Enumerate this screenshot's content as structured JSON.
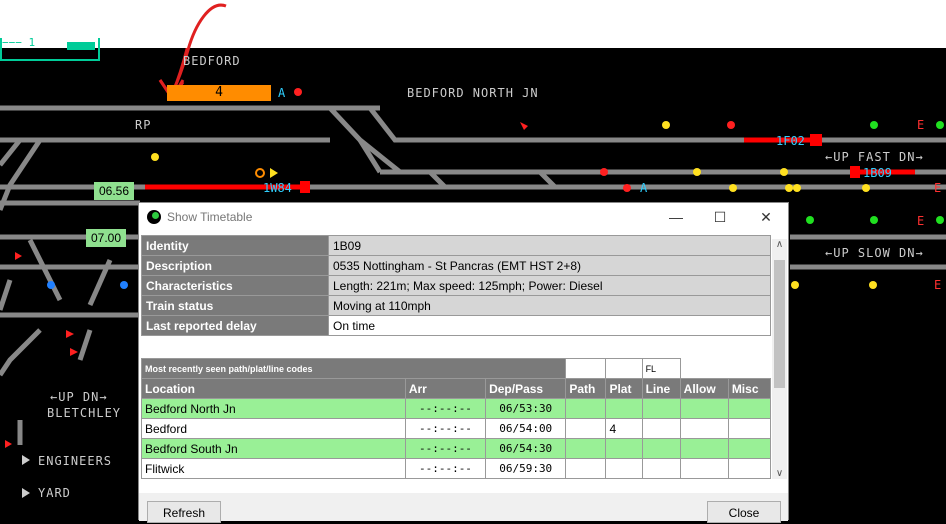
{
  "top_panel_text": "−−− 1",
  "labels": {
    "bedford": "BEDFORD",
    "bedford_north_jn": "BEDFORD NORTH JN",
    "rp": "RP",
    "up_fast_dn": "←UP FAST DN→",
    "up_slow_dn": "←UP SLOW DN→",
    "up_dn": "←UP DN→",
    "bletchley": "BLETCHLEY",
    "engineers": "ENGINEERS",
    "yard": "YARD"
  },
  "berths": {
    "bedford_plat4": "4",
    "train_1f02": "1F02",
    "train_1w84": "1W84",
    "train_1b09": "1B09",
    "sig_a1": "A",
    "sig_a2": "A",
    "sig_e1": "E",
    "sig_e2": "E",
    "sig_e3": "E",
    "sig_e4": "E"
  },
  "times": {
    "t1": "06.56",
    "t2": "07.00"
  },
  "dialog": {
    "title": "Show Timetable",
    "minimize": "—",
    "maximize": "☐",
    "close": "✕",
    "info": [
      {
        "key": "Identity",
        "value": "1B09"
      },
      {
        "key": "Description",
        "value": "0535 Nottingham - St Pancras (EMT HST 2+8)"
      },
      {
        "key": "Characteristics",
        "value": "Length: 221m; Max speed: 125mph; Power: Diesel"
      },
      {
        "key": "Train status",
        "value": "Moving at 110mph"
      },
      {
        "key": "Last reported delay",
        "value": "On time"
      }
    ],
    "codes_header": "Most recently seen path/plat/line codes",
    "codes_values": [
      "",
      "",
      "FL",
      ""
    ],
    "columns": [
      "Location",
      "Arr",
      "Dep/Pass",
      "Path",
      "Plat",
      "Line",
      "Allow",
      "Misc"
    ],
    "rows": [
      {
        "location": "Bedford North Jn",
        "arr": "--:--:--",
        "dep": "06/53:30",
        "path": "",
        "plat": "",
        "line": "",
        "allow": "",
        "misc": ""
      },
      {
        "location": "Bedford",
        "arr": "--:--:--",
        "dep": "06/54:00",
        "path": "",
        "plat": "4",
        "line": "",
        "allow": "",
        "misc": ""
      },
      {
        "location": "Bedford South Jn",
        "arr": "--:--:--",
        "dep": "06/54:30",
        "path": "",
        "plat": "",
        "line": "",
        "allow": "",
        "misc": ""
      },
      {
        "location": "Flitwick",
        "arr": "--:--:--",
        "dep": "06/59:30",
        "path": "",
        "plat": "",
        "line": "",
        "allow": "",
        "misc": ""
      }
    ],
    "buttons": {
      "refresh": "Refresh",
      "close": "Close"
    }
  },
  "colors": {
    "track": "#888888",
    "occupied": "#ff0000",
    "berth_orange": "#ff8c00",
    "timetable_green": "#8fe08f",
    "train_code": "#2fd0ff",
    "row_green": "#99f096",
    "annotation": "#e02020"
  }
}
